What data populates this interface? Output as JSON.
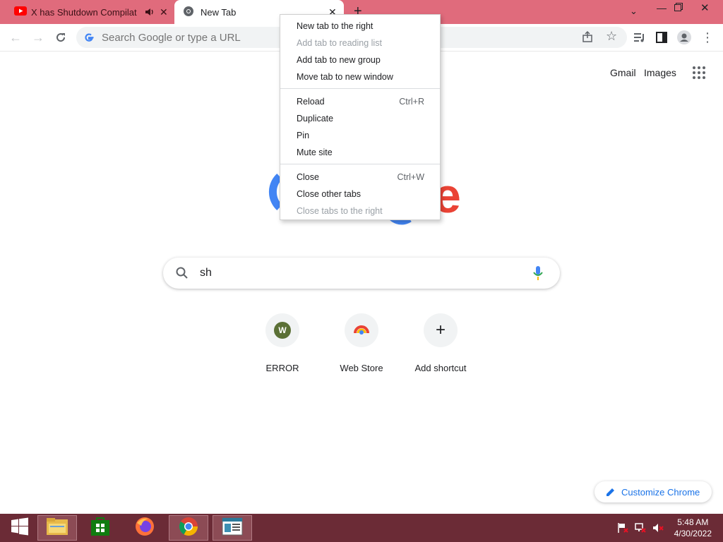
{
  "tabs": [
    {
      "title": "X has Shutdown Compilation",
      "icon": "youtube-icon",
      "audio_icon": "speaker-icon"
    },
    {
      "title": "New Tab",
      "icon": "chrome-icon"
    }
  ],
  "omnibox": {
    "placeholder": "Search Google or type a URL"
  },
  "ntp": {
    "links": {
      "gmail": "Gmail",
      "images": "Images"
    },
    "logo_partial": "e",
    "search_value": "sh",
    "shortcuts": [
      {
        "label": "ERROR",
        "badge": "W"
      },
      {
        "label": "Web Store"
      },
      {
        "label": "Add shortcut"
      }
    ],
    "customize_label": "Customize Chrome"
  },
  "context_menu": {
    "groups": [
      [
        {
          "label": "New tab to the right",
          "enabled": true
        },
        {
          "label": "Add tab to reading list",
          "enabled": false
        },
        {
          "label": "Add tab to new group",
          "enabled": true
        },
        {
          "label": "Move tab to new window",
          "enabled": true
        }
      ],
      [
        {
          "label": "Reload",
          "shortcut": "Ctrl+R",
          "enabled": true
        },
        {
          "label": "Duplicate",
          "enabled": true
        },
        {
          "label": "Pin",
          "enabled": true
        },
        {
          "label": "Mute site",
          "enabled": true
        }
      ],
      [
        {
          "label": "Close",
          "shortcut": "Ctrl+W",
          "enabled": true
        },
        {
          "label": "Close other tabs",
          "enabled": true
        },
        {
          "label": "Close tabs to the right",
          "enabled": false
        }
      ]
    ]
  },
  "taskbar": {
    "apps": [
      "start-icon",
      "file-explorer-icon",
      "store-icon",
      "firefox-icon",
      "chrome-icon",
      "news-app-icon"
    ],
    "clock": {
      "time": "5:48 AM",
      "date": "4/30/2022"
    }
  },
  "colors": {
    "tabstrip": "#e06b7c",
    "taskbar": "#6b2b36",
    "accent": "#1a73e8"
  }
}
